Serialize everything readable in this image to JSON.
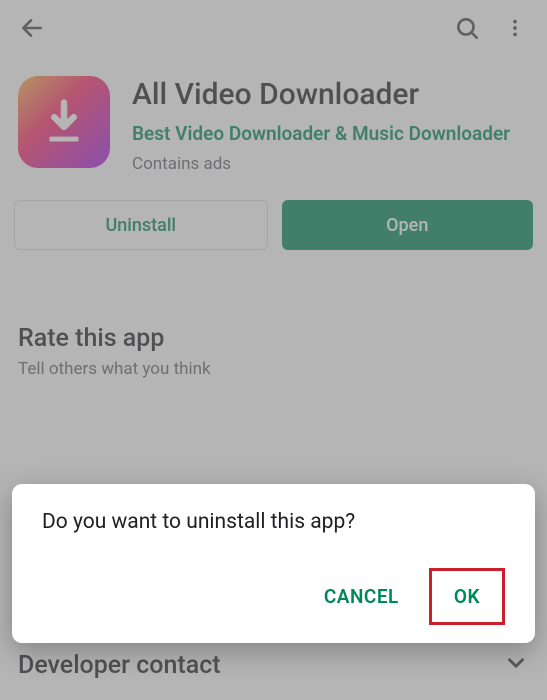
{
  "app": {
    "title": "All Video Downloader",
    "developer": "Best Video Downloader & Music Downloader",
    "ads_notice": "Contains ads"
  },
  "buttons": {
    "uninstall": "Uninstall",
    "open": "Open"
  },
  "rate": {
    "title": "Rate this app",
    "subtitle": "Tell others what you think"
  },
  "developer_section": {
    "title": "Developer contact"
  },
  "dialog": {
    "message": "Do you want to uninstall this app?",
    "cancel": "CANCEL",
    "ok": "OK"
  }
}
